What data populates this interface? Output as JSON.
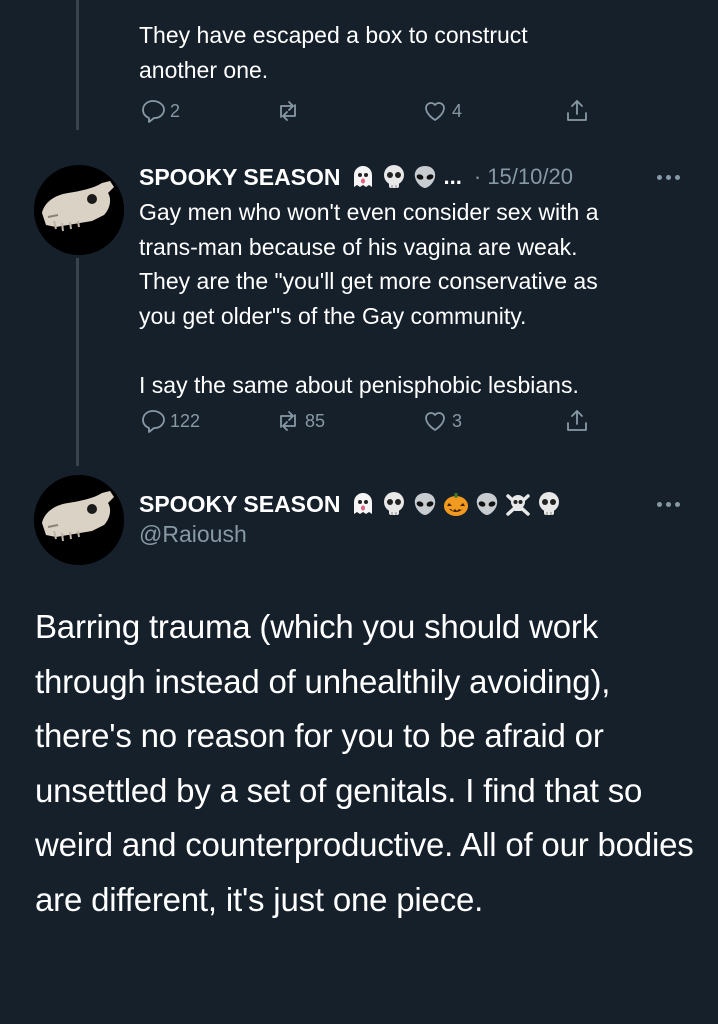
{
  "prior_tweet": {
    "text": "They have escaped a box to construct\nanother one.",
    "replies": "2",
    "retweets": "",
    "likes": "4"
  },
  "reply_tweet": {
    "display_name": "SPOOKY SEASON",
    "truncation": "...",
    "date": "· 15/10/20",
    "text": "Gay men who won't even consider sex with a\ntrans-man because of his vagina are weak.\nThey are the \"you'll get more conservative as\nyou get older\"s of the Gay community.\n\nI say the same about penisphobic lesbians.",
    "replies": "122",
    "retweets": "85",
    "likes": "3",
    "emojis": [
      "ghost-emoji",
      "skull-emoji",
      "alien-emoji"
    ]
  },
  "main_tweet": {
    "display_name": "SPOOKY SEASON",
    "handle": "@Raioush",
    "text": "Barring trauma (which you should work through instead of unhealthily avoiding), there's no reason for you to be afraid or unsettled by a set of genitals. I find that so weird and counterproductive. All of our bodies are different, it's just one piece.",
    "emojis": [
      "ghost-emoji",
      "skull-emoji",
      "alien-emoji",
      "jack-o-lantern-emoji",
      "alien-emoji",
      "skull-crossbones-emoji",
      "skull-emoji"
    ]
  },
  "colors": {
    "background": "#15202b",
    "text": "#ffffff",
    "secondary": "#8899a6",
    "thread_line": "#38444d"
  }
}
